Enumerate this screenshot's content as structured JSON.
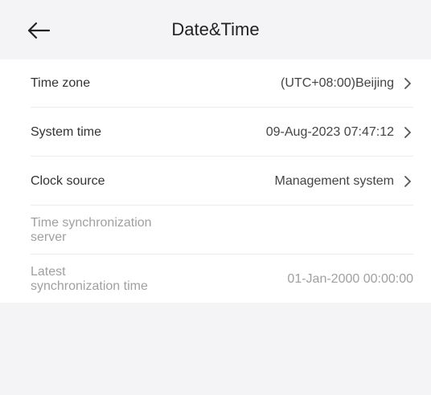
{
  "header": {
    "title": "Date&Time",
    "back_icon": "arrow-left-icon"
  },
  "settings": {
    "time_zone": {
      "label": "Time zone",
      "value": "(UTC+08:00)Beijing"
    },
    "system_time": {
      "label": "System time",
      "value": "09-Aug-2023 07:47:12"
    },
    "clock_source": {
      "label": "Clock source",
      "value": "Management system"
    },
    "sync_server": {
      "label_line1": "Time synchronization",
      "label_line2": "server"
    },
    "latest_sync": {
      "label_line1": "Latest",
      "label_line2": "synchronization time",
      "value": "01-Jan-2000 00:00:00"
    }
  },
  "colors": {
    "background": "#f4f4f6",
    "panel": "#ffffff",
    "text": "#333333",
    "disabled_text": "#a0a0a0",
    "divider": "#ececec"
  }
}
